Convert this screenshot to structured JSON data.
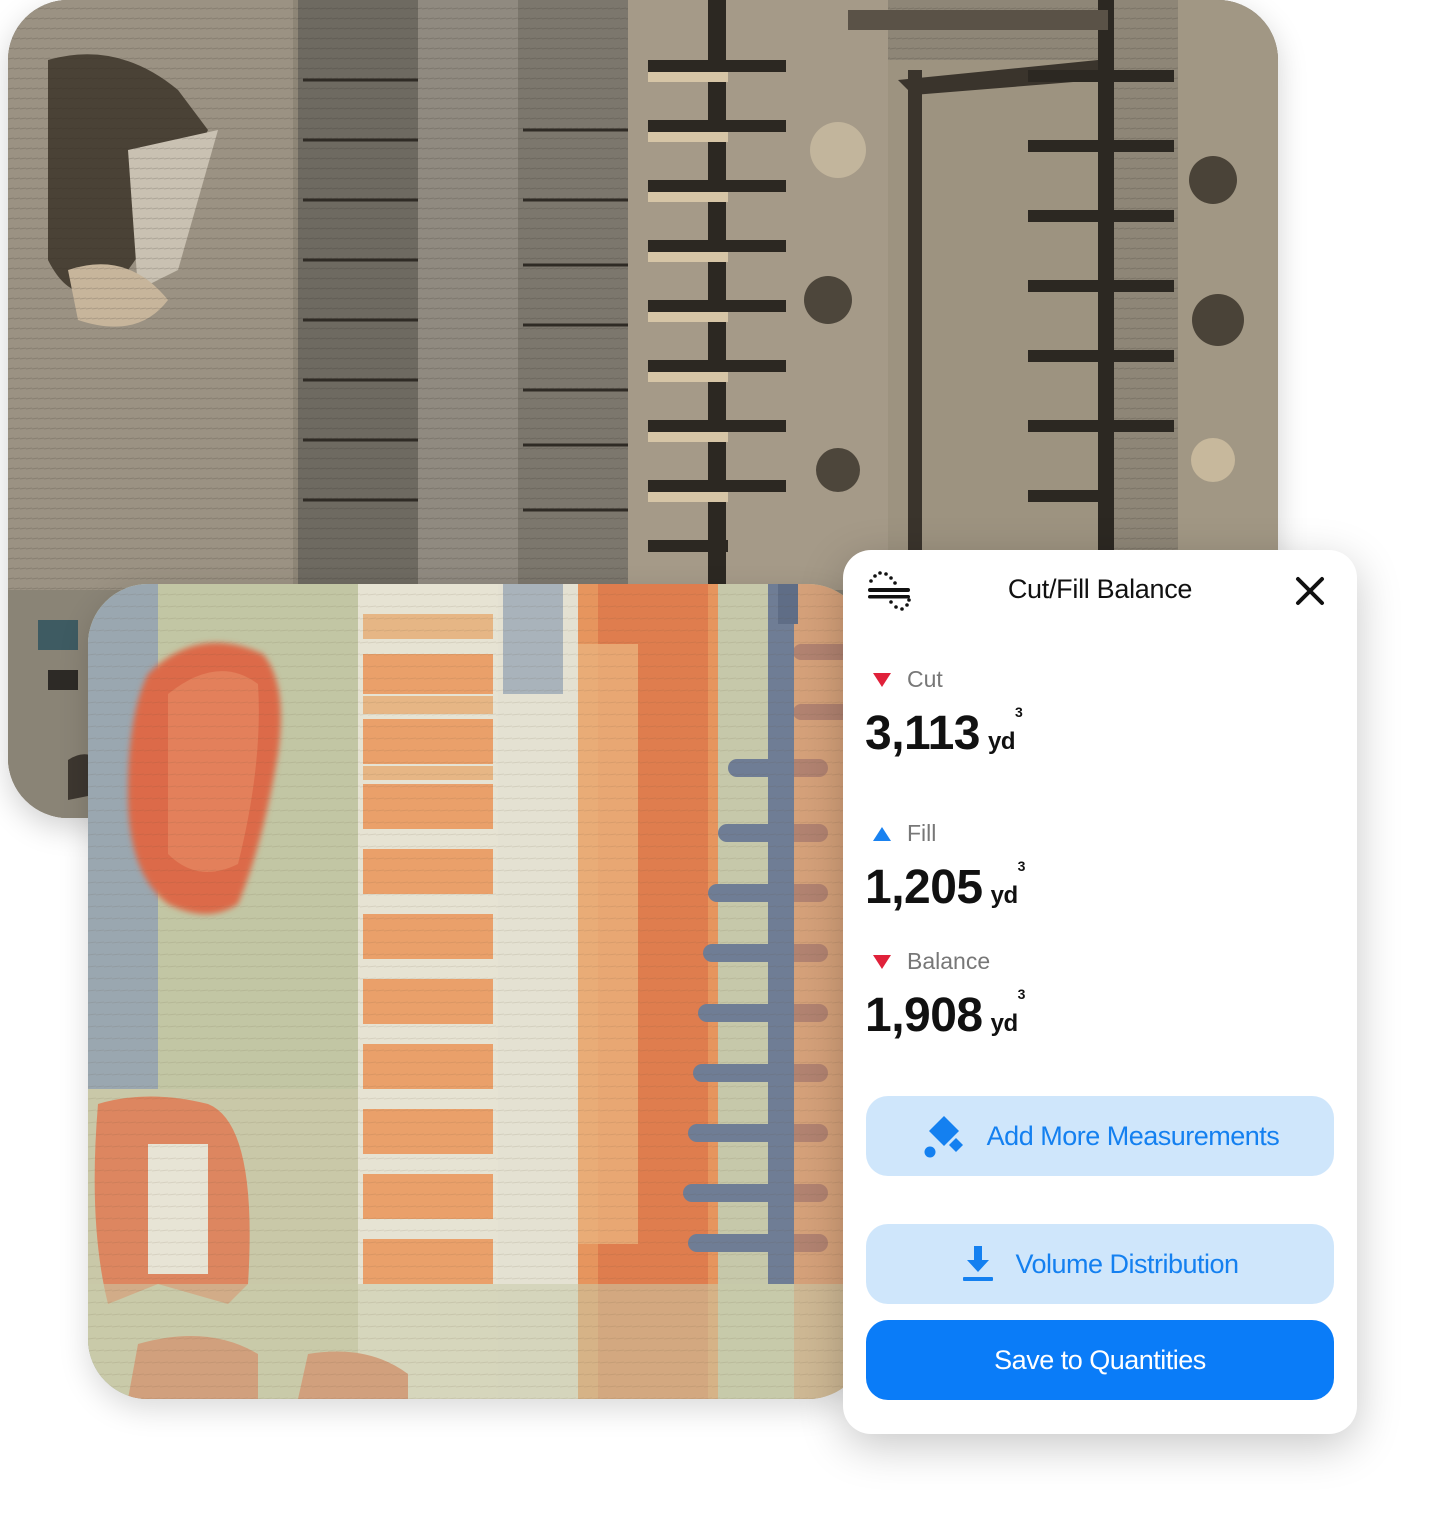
{
  "panel": {
    "title": "Cut/Fill Balance",
    "close_icon": "close-icon",
    "header_icon": "cut-fill-icon",
    "metrics": [
      {
        "label": "Cut",
        "value": "3,113",
        "unit": "yd",
        "unit_sup": "3",
        "direction": "down",
        "color": "#e0213a"
      },
      {
        "label": "Fill",
        "value": "1,205",
        "unit": "yd",
        "unit_sup": "3",
        "direction": "up",
        "color": "#1a82f0"
      },
      {
        "label": "Balance",
        "value": "1,908",
        "unit": "yd",
        "unit_sup": "3",
        "direction": "down",
        "color": "#e0213a"
      }
    ],
    "buttons": {
      "add_measurements": "Add More Measurements",
      "volume_distribution": "Volume Distribution",
      "save_quantities": "Save to Quantities"
    }
  },
  "colors": {
    "accent": "#0a7cf8",
    "accent_light": "#cfe6fb",
    "accent_text": "#1480f0",
    "cut": "#e0213a",
    "fill": "#1a82f0"
  }
}
